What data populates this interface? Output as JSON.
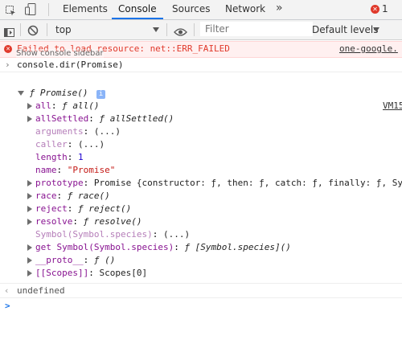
{
  "tabs": [
    "Elements",
    "Console",
    "Sources",
    "Network"
  ],
  "active_tab": "Console",
  "more_tabs_icon": "chevrons-right",
  "error_count": "1",
  "toolbar": {
    "context": "top",
    "filter_placeholder": "Filter",
    "levels": "Default levels"
  },
  "tooltip": "Show console sidebar",
  "error_message": "Failed to load resource: net::ERR_FAILED",
  "error_source": "one-google.",
  "command": "console.dir(Promise)",
  "vm_link": "VM15",
  "object": {
    "title": "ƒ Promise()",
    "info_badge": "i",
    "props": [
      {
        "key": "all",
        "value": "ƒ all()",
        "expandable": true,
        "dim": false
      },
      {
        "key": "allSettled",
        "value": "ƒ allSettled()",
        "expandable": true,
        "dim": false
      },
      {
        "key": "arguments",
        "value": "(...)",
        "expandable": false,
        "dim": true
      },
      {
        "key": "caller",
        "value": "(...)",
        "expandable": false,
        "dim": true
      },
      {
        "key": "length",
        "value": "1",
        "expandable": false,
        "dim": false
      },
      {
        "key": "name",
        "value": "\"Promise\"",
        "expandable": false,
        "dim": false
      },
      {
        "key": "prototype",
        "value": "Promise {constructor: ƒ, then: ƒ, catch: ƒ, finally: ƒ, Sy",
        "expandable": true,
        "dim": false
      },
      {
        "key": "race",
        "value": "ƒ race()",
        "expandable": true,
        "dim": false
      },
      {
        "key": "reject",
        "value": "ƒ reject()",
        "expandable": true,
        "dim": false
      },
      {
        "key": "resolve",
        "value": "ƒ resolve()",
        "expandable": true,
        "dim": false
      },
      {
        "key": "Symbol(Symbol.species)",
        "value": "(...)",
        "expandable": false,
        "dim": true
      },
      {
        "key": "get Symbol(Symbol.species)",
        "value": "ƒ [Symbol.species]()",
        "expandable": true,
        "dim": false
      },
      {
        "key": "__proto__",
        "value": "ƒ ()",
        "expandable": true,
        "dim": false
      },
      {
        "key": "[[Scopes]]",
        "value": "Scopes[0]",
        "expandable": true,
        "dim": false
      }
    ]
  },
  "result": "undefined",
  "prompt_symbol": ">"
}
